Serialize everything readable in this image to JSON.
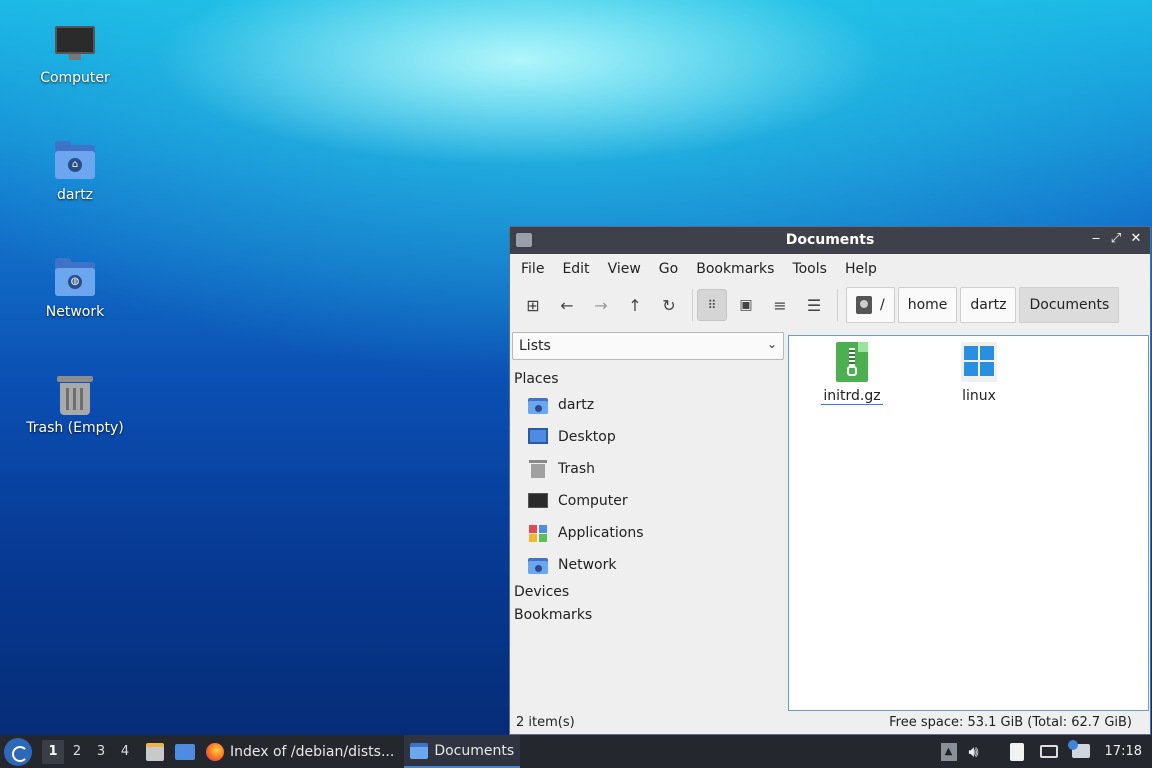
{
  "desktop": {
    "icons": [
      {
        "label": "Computer",
        "icon": "computer-icon"
      },
      {
        "label": "dartz",
        "icon": "home-folder-icon"
      },
      {
        "label": "Network",
        "icon": "network-folder-icon"
      },
      {
        "label": "Trash (Empty)",
        "icon": "trash-icon"
      }
    ]
  },
  "window": {
    "title": "Documents",
    "controls": {
      "minimize": "‒",
      "maximize": "⤢",
      "close": "✕"
    },
    "menu": [
      "File",
      "Edit",
      "View",
      "Go",
      "Bookmarks",
      "Tools",
      "Help"
    ],
    "toolbar": {
      "buttons": [
        "new-tab-icon",
        "back-icon",
        "forward-icon",
        "up-icon",
        "reload-icon",
        "icon-view-icon",
        "thumbnail-view-icon",
        "compact-view-icon",
        "detailed-list-view-icon"
      ],
      "breadcrumbs": [
        "/",
        "home",
        "dartz",
        "Documents"
      ]
    },
    "sidebar": {
      "dropdown_value": "Lists",
      "places_header": "Places",
      "places": [
        "dartz",
        "Desktop",
        "Trash",
        "Computer",
        "Applications",
        "Network"
      ],
      "devices_header": "Devices",
      "bookmarks_header": "Bookmarks"
    },
    "files": [
      {
        "name": "initrd.gz",
        "icon": "archive-icon"
      },
      {
        "name": "linux",
        "icon": "windows-logo-icon"
      }
    ],
    "status": {
      "count": "2 item(s)",
      "free_space": "Free space: 53.1 GiB (Total: 62.7 GiB)"
    }
  },
  "taskbar": {
    "workspaces": [
      "1",
      "2",
      "3",
      "4"
    ],
    "active_workspace": "1",
    "tasks": [
      {
        "label": "Index of /debian/dists...",
        "icon": "firefox-icon"
      },
      {
        "label": "Documents",
        "icon": "folder-icon"
      }
    ],
    "clock": "17:18"
  },
  "colors": {
    "accent": "#3f86d8",
    "titlebar": "#3e4149",
    "taskbar": "#24272e"
  }
}
